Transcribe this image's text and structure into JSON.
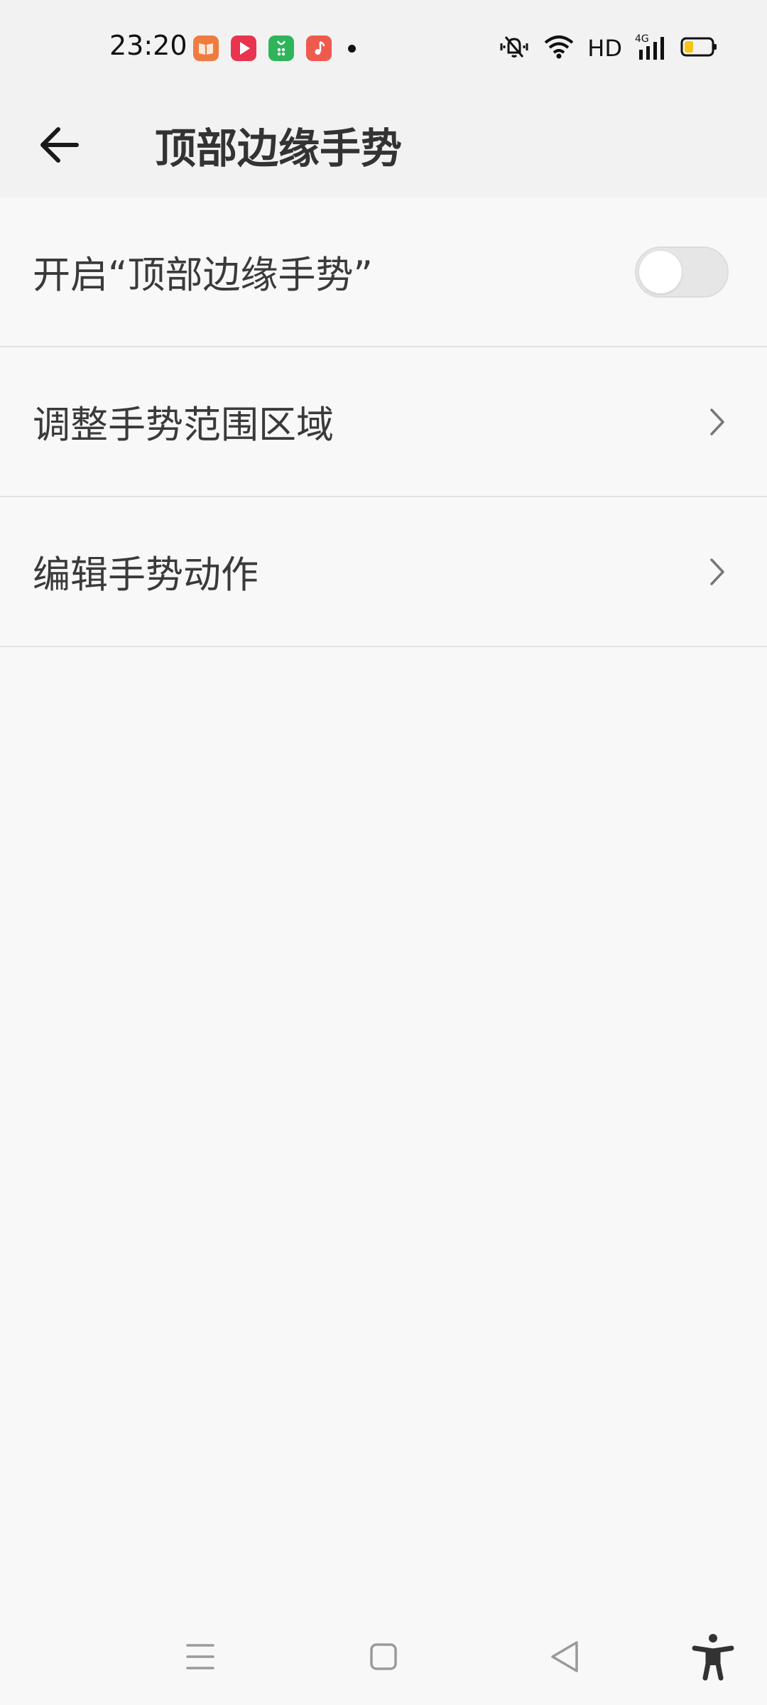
{
  "status_bar": {
    "time": "23:20",
    "app_icons": [
      "reader-app-icon",
      "video-app-icon",
      "store-app-icon",
      "music-app-icon"
    ],
    "network_label": "HD",
    "signal_type": "4G",
    "icons": [
      "mute-vibrate-icon",
      "wifi-icon",
      "signal-icon",
      "battery-icon"
    ]
  },
  "header": {
    "title": "顶部边缘手势",
    "back_icon": "back-arrow-icon"
  },
  "settings": {
    "items": [
      {
        "label": "开启“顶部边缘手势”",
        "control": "toggle",
        "enabled": false
      },
      {
        "label": "调整手势范围区域",
        "control": "chevron"
      },
      {
        "label": "编辑手势动作",
        "control": "chevron"
      }
    ]
  },
  "nav_bar": {
    "icons": [
      "menu-icon",
      "home-icon",
      "back-icon",
      "accessibility-icon"
    ]
  },
  "colors": {
    "header_bg": "#f2f2f2",
    "page_bg": "#f8f8f8",
    "text": "#333333",
    "divider": "#e2e2e2"
  }
}
